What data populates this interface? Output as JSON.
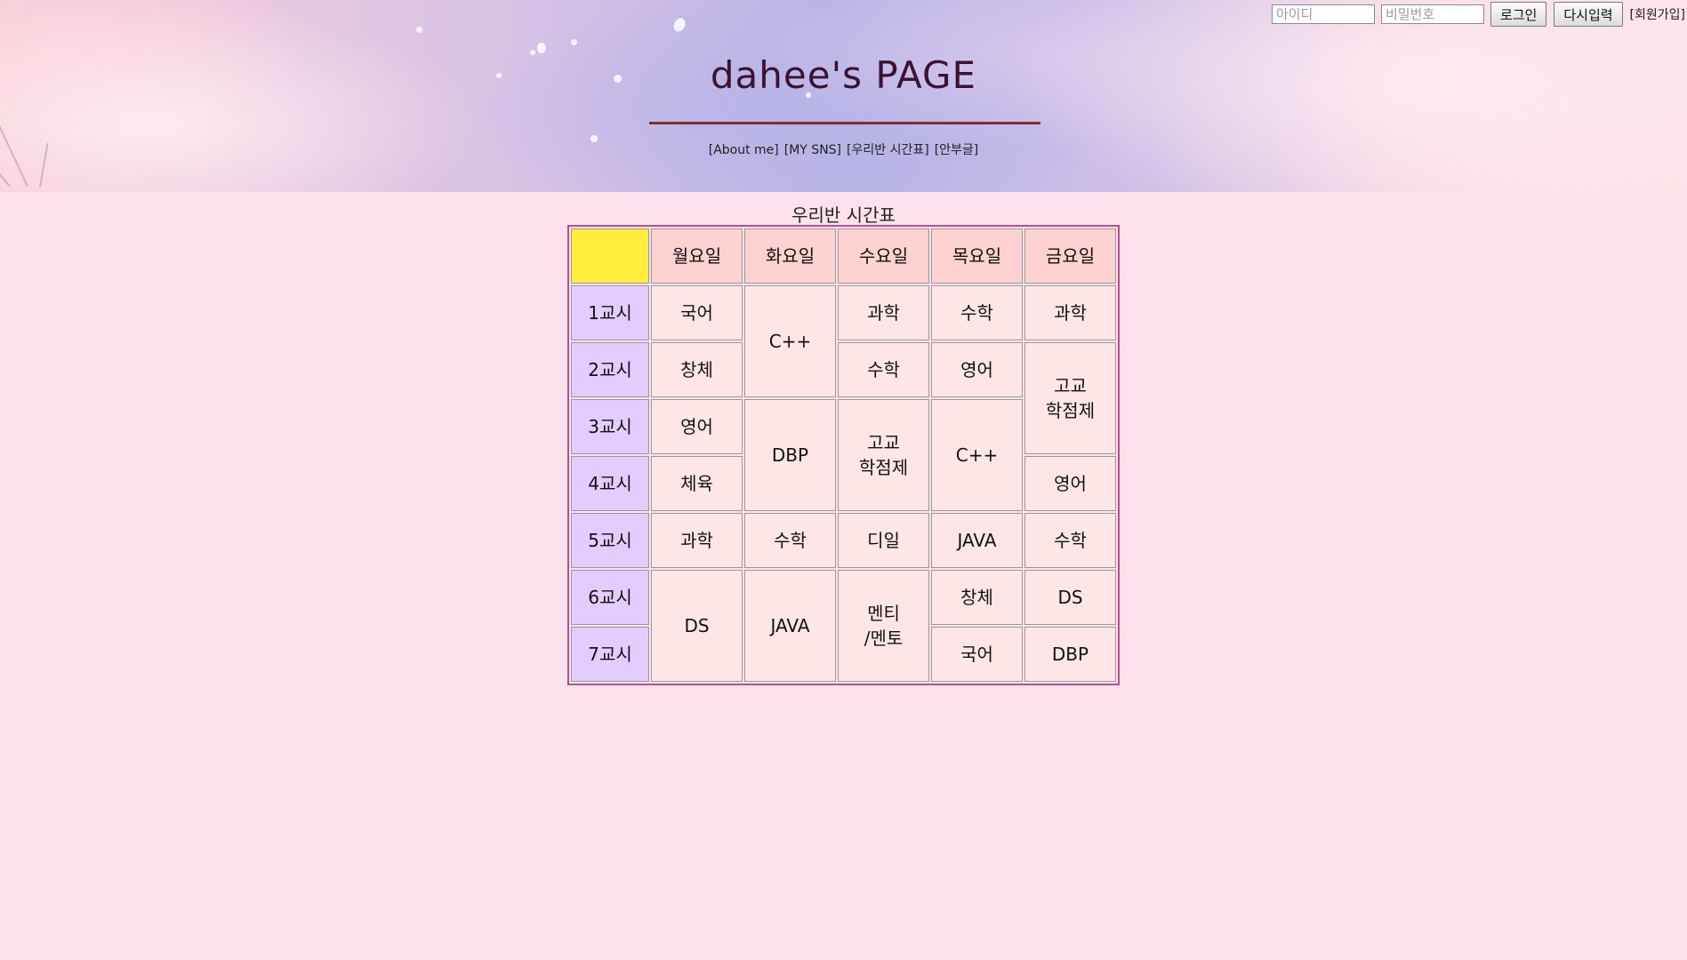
{
  "header": {
    "title": "dahee's PAGE",
    "nav": [
      "[About me]",
      "[MY SNS]",
      "[우리반 시간표]",
      "[안부글]"
    ]
  },
  "login": {
    "id_placeholder": "아이디",
    "pw_placeholder": "비밀번호",
    "login_label": "로그인",
    "reset_label": "다시입력",
    "join_label": "[회원가입]"
  },
  "timetable": {
    "caption": "우리반 시간표",
    "days": [
      "월요일",
      "화요일",
      "수요일",
      "목요일",
      "금요일"
    ],
    "periods": [
      "1교시",
      "2교시",
      "3교시",
      "4교시",
      "5교시",
      "6교시",
      "7교시"
    ],
    "cells": {
      "mon1": "국어",
      "mon2": "창체",
      "mon3": "영어",
      "mon4": "체육",
      "mon5": "과학",
      "mon67": "DS",
      "tue12": "C++",
      "tue34": "DBP",
      "tue5": "수학",
      "tue67": "JAVA",
      "wed1": "과학",
      "wed2": "수학",
      "wed34": "고교\n학점제",
      "wed5": "디일",
      "wed67": "멘티\n/멘토",
      "thu1": "수학",
      "thu2": "영어",
      "thu34": "C++",
      "thu5": "JAVA",
      "thu6": "창체",
      "thu7": "국어",
      "fri1": "과학",
      "fri23": "고교\n학점제",
      "fri4": "영어",
      "fri5": "수학",
      "fri6": "DS",
      "fri7": "DBP"
    }
  },
  "colors": {
    "page_background": "#fde2ee",
    "corner_cell": "#ffec3d",
    "day_header": "#ffd2d2",
    "period_header": "#e4ccff",
    "class_cell": "#ffe6e6",
    "table_border": "#b0508a",
    "title_rule": "#7a3030"
  }
}
